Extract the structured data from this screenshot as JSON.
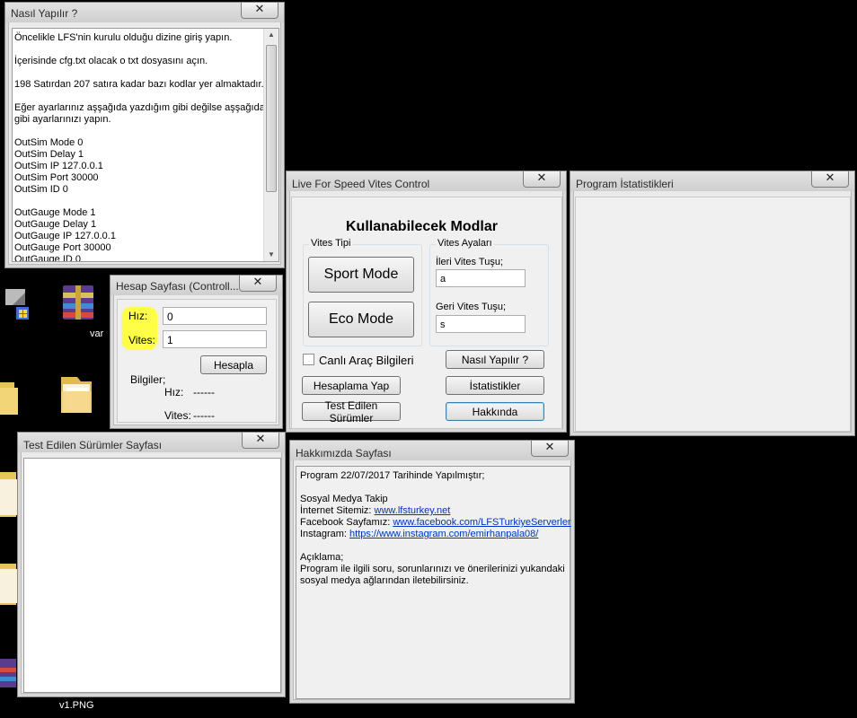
{
  "colors": {
    "highlight": "#ffff00",
    "link": "#0033cc",
    "desktop": "#000000"
  },
  "nasil": {
    "title": "Nasıl Yapılır ?",
    "close": "✕",
    "lines": [
      "Öncelikle LFS'nin kurulu olduğu dizine giriş yapın.",
      "",
      "İçerisinde cfg.txt olacak o txt dosyasını açın.",
      "",
      "198 Satırdan 207 satıra kadar bazı kodlar yer almaktadır.",
      "",
      "Eğer ayarlarınız aşşağıda yazdığım gibi değilse aşşağıdaki",
      "gibi ayarlarınızı yapın.",
      "",
      "OutSim Mode 0",
      "OutSim Delay 1",
      "OutSim IP 127.0.0.1",
      "OutSim Port 30000",
      "OutSim ID 0",
      "",
      "OutGauge Mode 1",
      "OutGauge Delay 1",
      "OutGauge IP 127.0.0.1",
      "OutGauge Port 30000",
      "OutGauge ID 0"
    ]
  },
  "hesap": {
    "title": "Hesap Sayfası (Controll...",
    "close": "✕",
    "hiz_label": "Hız:",
    "hiz_value": "0",
    "vites_label": "Vites:",
    "vites_value": "1",
    "hesapla": "Hesapla",
    "bilgiler": "Bilgiler;",
    "info_hiz_label": "Hız:",
    "info_hiz_value": "------",
    "info_vites_label": "Vites:",
    "info_vites_value": "------"
  },
  "main": {
    "title": "Live For Speed Vites Control",
    "close": "✕",
    "heading": "Kullanabilecek Modlar",
    "vites_tipi": "Vites Tipi",
    "sport": "Sport Mode",
    "eco": "Eco Mode",
    "vites_ayarlari": "Vites Ayaları",
    "ileri_label": "İleri Vites Tuşu;",
    "ileri_value": "a",
    "geri_label": "Geri Vites Tuşu;",
    "geri_value": "s",
    "canli": "Canlı Araç Bilgileri",
    "nasil_btn": "Nasıl Yapılır ?",
    "hesaplama_btn": "Hesaplama Yap",
    "istatistik_btn": "İstatistikler",
    "surumler_btn": "Test Edilen Sürümler",
    "hakkinda_btn": "Hakkında"
  },
  "stats": {
    "title": "Program İstatistikleri",
    "close": "✕"
  },
  "surumler": {
    "title": "Test Edilen Sürümler Sayfası",
    "close": "✕"
  },
  "hakkimizda": {
    "title": "Hakkımızda Sayfası",
    "close": "✕",
    "line1": "Program 22/07/2017 Tarihinde Yapılmıştır;",
    "sosyal": "Sosyal Medya Takip",
    "internet_label": "İnternet Sitemiz: ",
    "internet_link": "www.lfsturkey.net",
    "facebook_label": "Facebook Sayfamız: ",
    "facebook_link": "www.facebook.com/LFSTurkiyeServerler",
    "instagram_label": "Instagram: ",
    "instagram_link": "https://www.instagram.com/emirhanpala08/",
    "aciklama": "Açıklama;",
    "desc1": "Program ile ilgili soru, sorunlarınızı ve önerilerinizi yukandaki",
    "desc2": "sosyal medya ağlarından iletebilirsiniz."
  },
  "desktop": {
    "file_label": "v1.PNG",
    "partial_label": "var"
  }
}
